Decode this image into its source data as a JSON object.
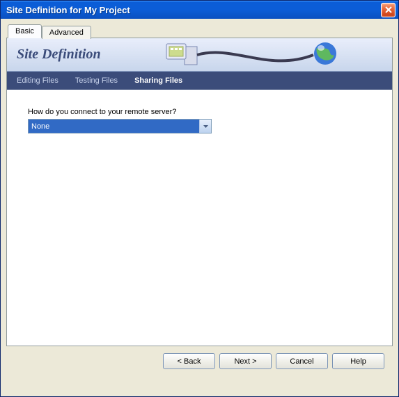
{
  "window": {
    "title": "Site Definition for My Project"
  },
  "tabs": {
    "basic": "Basic",
    "advanced": "Advanced"
  },
  "banner": {
    "title": "Site Definition"
  },
  "wizard_steps": {
    "editing": "Editing Files",
    "testing": "Testing Files",
    "sharing": "Sharing Files"
  },
  "form": {
    "question": "How do you connect to your remote server?",
    "selected_value": "None"
  },
  "buttons": {
    "back": "< Back",
    "next": "Next >",
    "cancel": "Cancel",
    "help": "Help"
  }
}
